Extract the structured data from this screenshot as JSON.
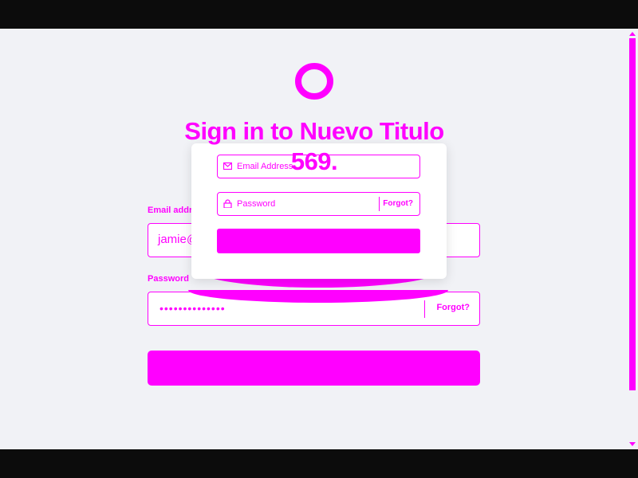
{
  "page": {
    "title": "Sign in to Nuevo Titulo 569.",
    "brand_color": "#ff00ff",
    "logo_icon": "ring-logo-icon"
  },
  "form": {
    "email_label": "Email address",
    "email_value": "jamie@exa",
    "password_label": "Password",
    "password_value": "••••••••••••••",
    "forgot_label": "Forgot?"
  },
  "popup": {
    "email_placeholder": "Email Address",
    "password_placeholder": "Password",
    "forgot_label": "Forgot?"
  }
}
